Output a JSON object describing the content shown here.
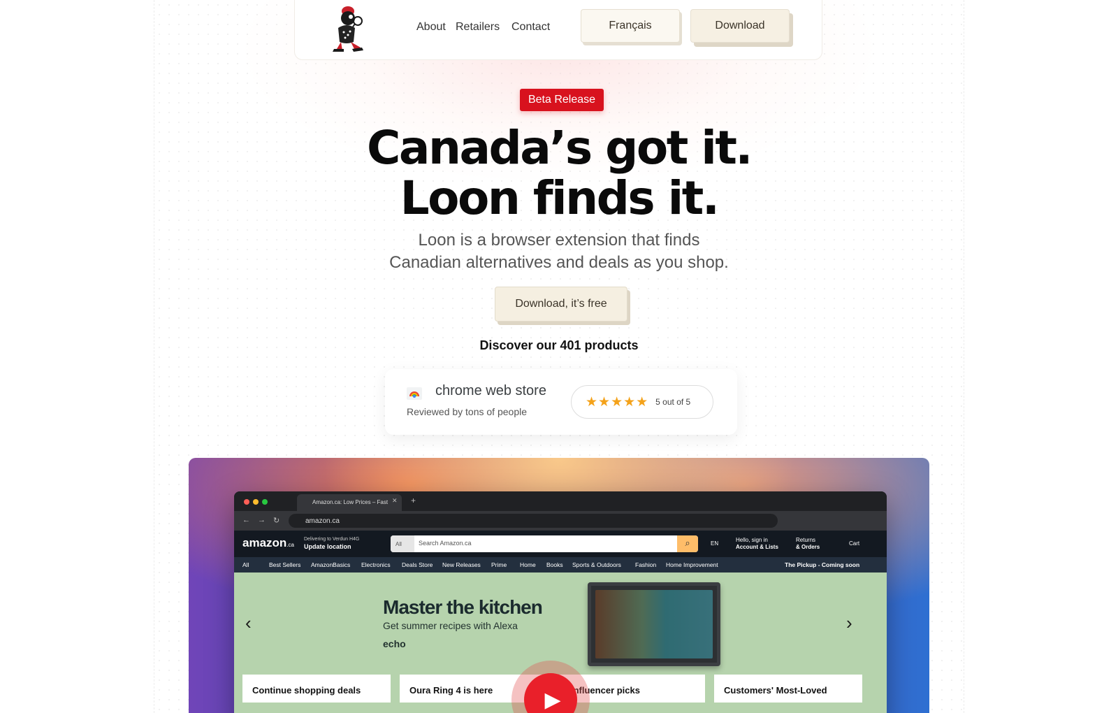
{
  "nav": {
    "links": [
      "About",
      "Retailers",
      "Contact"
    ],
    "language_button": "Français",
    "download_button": "Download"
  },
  "hero": {
    "badge": "Beta Release",
    "headline_line1": "Canada’s got it.",
    "headline_line2": "Loon finds it.",
    "subhead_line1": "Loon is a browser extension that finds",
    "subhead_line2": "Canadian alternatives and deals as you shop.",
    "cta": "Download, it’s free",
    "discover_prefix": "Discover our ",
    "discover_count": "401",
    "discover_suffix": " products"
  },
  "store": {
    "name": "chrome web store",
    "subtitle": "Reviewed by tons of people",
    "stars": "★★★★★",
    "rating": "5 out of 5",
    "rating_value": 5,
    "rating_max": 5
  },
  "video": {
    "browser": {
      "tab_title": "Amazon.ca: Low Prices – Fast",
      "url": "amazon.ca"
    },
    "amazon": {
      "logo": "amazon",
      "logo_suffix": ".ca",
      "deliver_line1": "Delivering to Verdun H4G",
      "deliver_line2": "Update location",
      "search_category": "All",
      "search_placeholder": "Search Amazon.ca",
      "lang": "EN",
      "account_line1": "Hello, sign in",
      "account_line2": "Account & Lists",
      "returns_line1": "Returns",
      "returns_line2": "& Orders",
      "cart": "Cart",
      "nav_items": [
        "All",
        "Best Sellers",
        "AmazonBasics",
        "Electronics",
        "Deals Store",
        "New Releases",
        "Prime",
        "Home",
        "Books",
        "Sports & Outdoors",
        "Fashion",
        "Home Improvement"
      ],
      "nav_promo": "The Pickup - Coming soon",
      "hero_title": "Master the kitchen",
      "hero_sub": "Get summer recipes with Alexa",
      "hero_brand": "echo",
      "cards": [
        "Continue shopping deals",
        "Oura Ring 4 is here",
        "Influencer picks",
        "Customers' Most-Loved"
      ]
    }
  }
}
